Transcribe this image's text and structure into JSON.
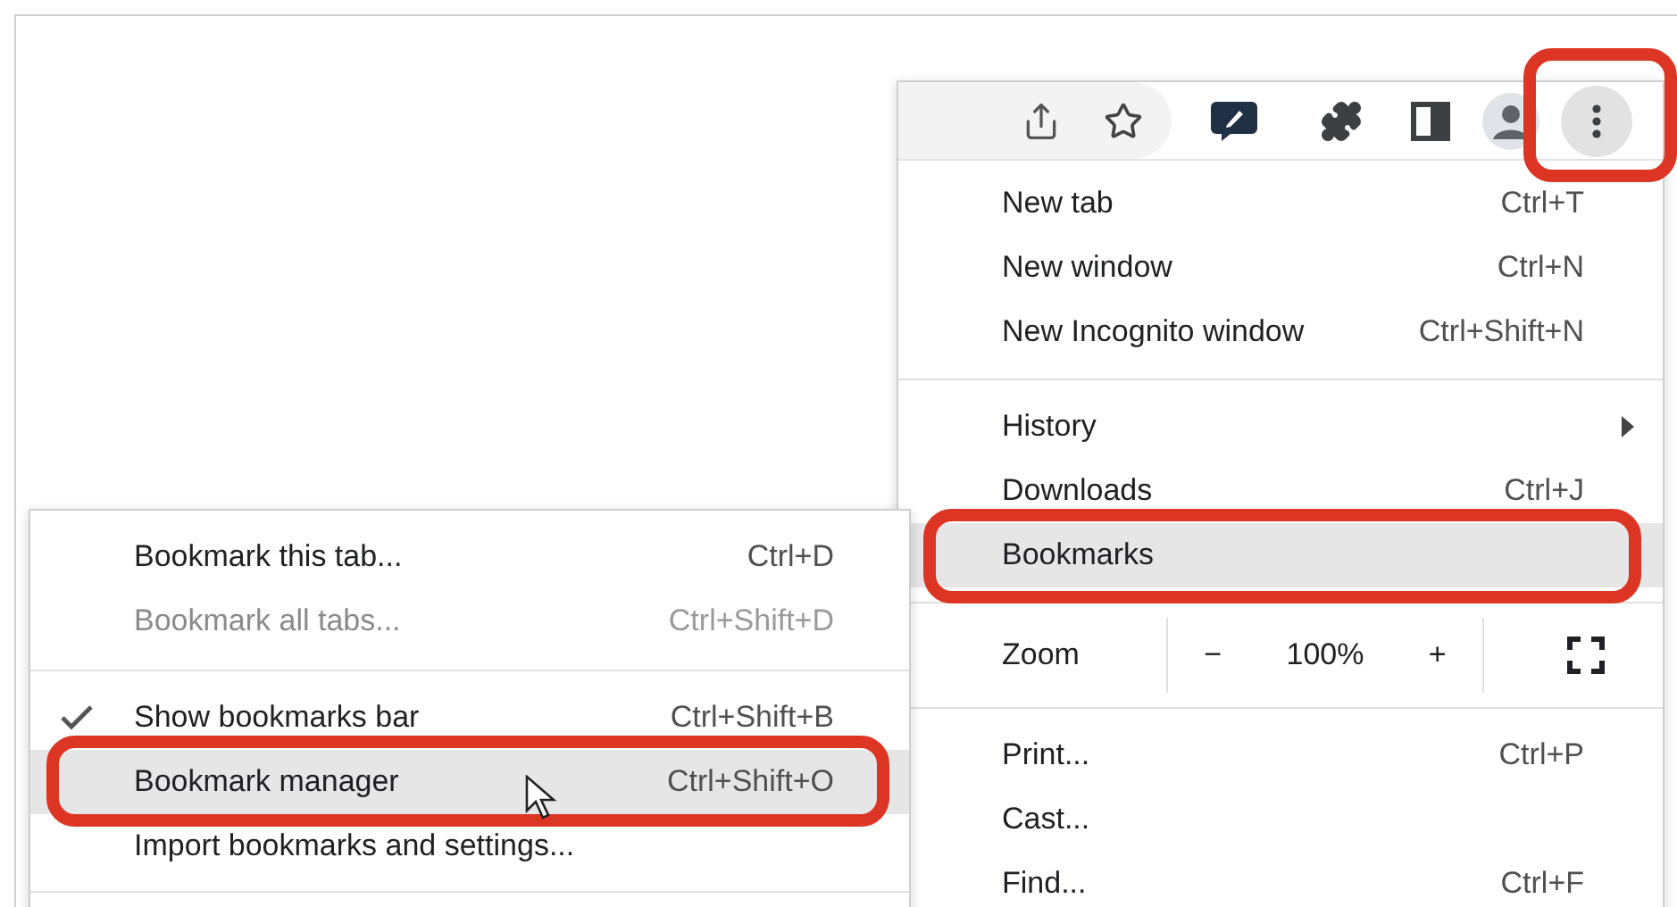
{
  "main_menu": {
    "items": [
      {
        "kind": "item",
        "label": "New tab",
        "shortcut": "Ctrl+T",
        "selected": false,
        "submenu": false
      },
      {
        "kind": "item",
        "label": "New window",
        "shortcut": "Ctrl+N",
        "selected": false,
        "submenu": false
      },
      {
        "kind": "item",
        "label": "New Incognito window",
        "shortcut": "Ctrl+Shift+N",
        "selected": false,
        "submenu": false
      },
      {
        "kind": "separator"
      },
      {
        "kind": "item",
        "label": "History",
        "selected": false,
        "submenu": true
      },
      {
        "kind": "item",
        "label": "Downloads",
        "shortcut": "Ctrl+J",
        "selected": false,
        "submenu": false
      },
      {
        "kind": "item",
        "label": "Bookmarks",
        "selected": true,
        "submenu": false
      },
      {
        "kind": "separator"
      },
      {
        "kind": "zoom",
        "label": "Zoom",
        "minus": "−",
        "value": "100%",
        "plus": "+"
      },
      {
        "kind": "separator"
      },
      {
        "kind": "item",
        "label": "Print...",
        "shortcut": "Ctrl+P",
        "selected": false,
        "submenu": false
      },
      {
        "kind": "item",
        "label": "Cast...",
        "selected": false,
        "submenu": false
      },
      {
        "kind": "item",
        "label": "Find...",
        "shortcut": "Ctrl+F",
        "selected": false,
        "submenu": false
      }
    ]
  },
  "bookmarks_submenu": {
    "items": [
      {
        "kind": "item",
        "label": "Bookmark this tab...",
        "shortcut": "Ctrl+D",
        "selected": false,
        "disabled": false,
        "checked": false
      },
      {
        "kind": "item",
        "label": "Bookmark all tabs...",
        "shortcut": "Ctrl+Shift+D",
        "selected": false,
        "disabled": true,
        "checked": false
      },
      {
        "kind": "separator"
      },
      {
        "kind": "item",
        "label": "Show bookmarks bar",
        "shortcut": "Ctrl+Shift+B",
        "selected": false,
        "disabled": false,
        "checked": true
      },
      {
        "kind": "item",
        "label": "Bookmark manager",
        "shortcut": "Ctrl+Shift+O",
        "selected": true,
        "disabled": false,
        "checked": false
      },
      {
        "kind": "item",
        "label": "Import bookmarks and settings...",
        "selected": false,
        "disabled": false,
        "checked": false
      }
    ]
  }
}
